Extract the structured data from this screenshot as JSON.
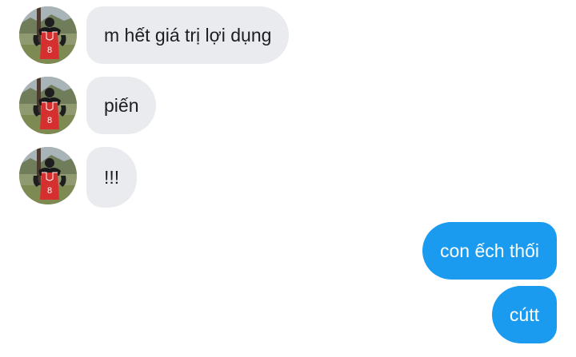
{
  "conversation": {
    "incoming": [
      {
        "text": "m hết giá trị lợi dụng",
        "avatar": "profile-photo-red-jersey"
      },
      {
        "text": "piến",
        "avatar": "profile-photo-red-jersey"
      },
      {
        "text": "!!!",
        "avatar": "profile-photo-red-jersey"
      }
    ],
    "outgoing": [
      {
        "text": "con ếch thối"
      },
      {
        "text": "cútt"
      }
    ]
  },
  "colors": {
    "incoming_bubble": "#e9ebee",
    "incoming_text": "#1c1e21",
    "outgoing_bubble": "#1a9bf0",
    "outgoing_text": "#ffffff",
    "background": "#ffffff"
  }
}
